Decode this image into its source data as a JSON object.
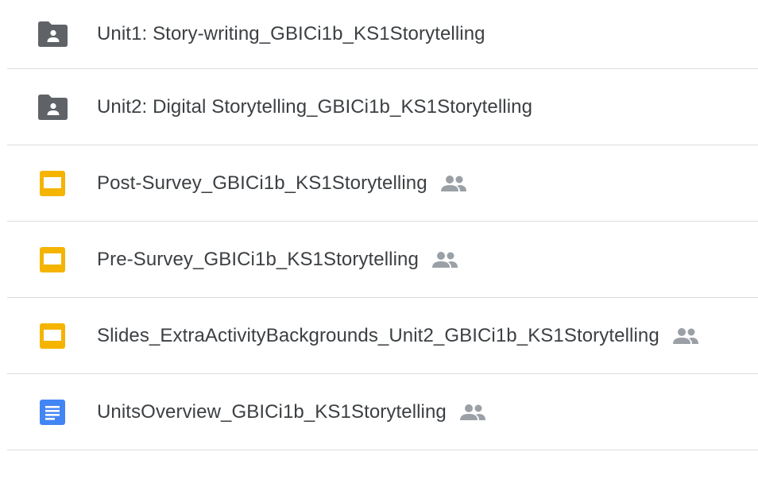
{
  "files": [
    {
      "type": "shared-folder",
      "icon": "shared-folder-icon",
      "name": "Unit1: Story-writing_GBICi1b_KS1Storytelling",
      "shared": false
    },
    {
      "type": "shared-folder",
      "icon": "shared-folder-icon",
      "name": "Unit2: Digital Storytelling_GBICi1b_KS1Storytelling",
      "shared": false
    },
    {
      "type": "slides",
      "icon": "google-slides-icon",
      "name": "Post-Survey_GBICi1b_KS1Storytelling",
      "shared": true
    },
    {
      "type": "slides",
      "icon": "google-slides-icon",
      "name": "Pre-Survey_GBICi1b_KS1Storytelling",
      "shared": true
    },
    {
      "type": "slides",
      "icon": "google-slides-icon",
      "name": "Slides_ExtraActivityBackgrounds_Unit2_GBICi1b_KS1Storytelling",
      "shared": true
    },
    {
      "type": "docs",
      "icon": "google-docs-icon",
      "name": "UnitsOverview_GBICi1b_KS1Storytelling",
      "shared": true
    }
  ],
  "colors": {
    "folder": "#5f6368",
    "slides": "#f4b400",
    "docs": "#4285f4",
    "shared_icon": "#9aa0a6",
    "divider": "#dadce0",
    "text": "#3c4043"
  }
}
